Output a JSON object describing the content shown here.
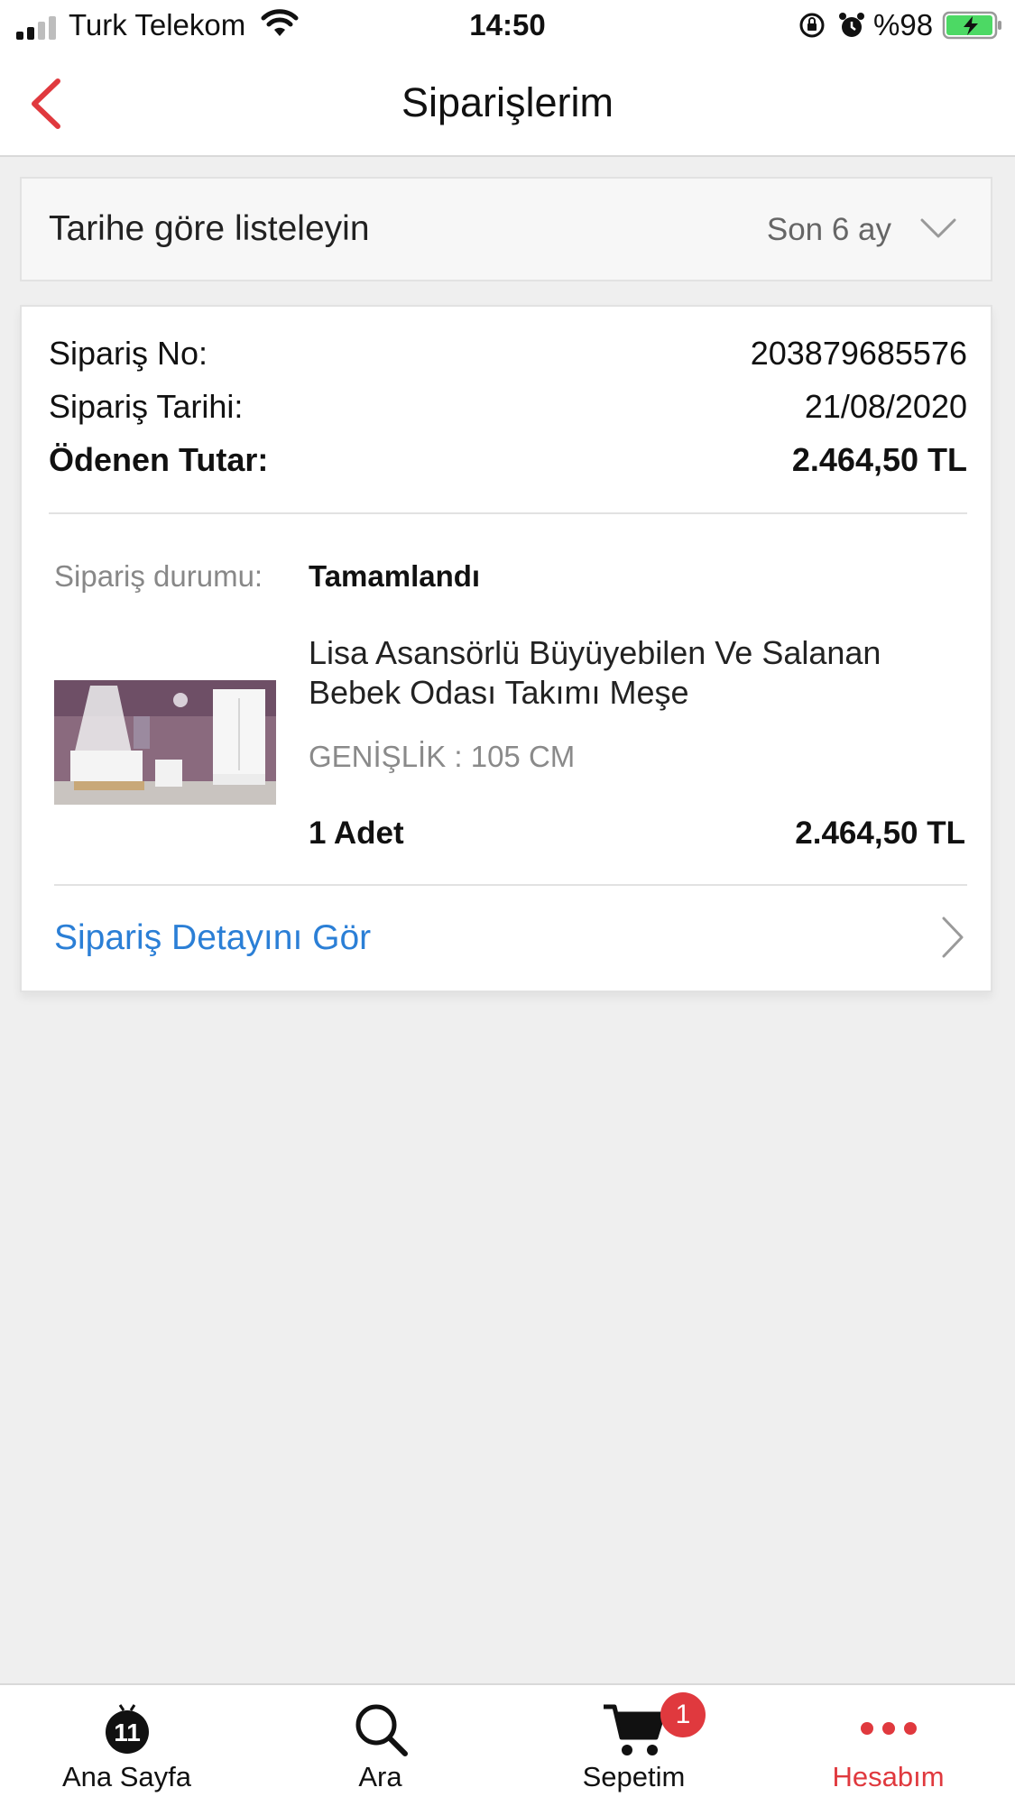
{
  "status_bar": {
    "carrier": "Turk Telekom",
    "time": "14:50",
    "battery_percent": "%98",
    "battery_level": 0.98
  },
  "nav": {
    "title": "Siparişlerim",
    "back_icon": "chevron-left-icon",
    "accent_color": "#e0393e"
  },
  "filter": {
    "label": "Tarihe göre listeleyin",
    "selected": "Son 6 ay",
    "icon": "chevron-down-icon"
  },
  "order": {
    "number_label": "Sipariş No:",
    "number": "203879685576",
    "date_label": "Sipariş Tarihi:",
    "date": "21/08/2020",
    "paid_label": "Ödenen Tutar:",
    "paid": "2.464,50 TL",
    "status_label": "Sipariş durumu:",
    "status": "Tamamlandı",
    "item": {
      "title": "Lisa Asansörlü Büyüyebilen Ve Salanan Bebek Odası Takımı Meşe",
      "variant": "GENİŞLİK : 105 CM",
      "quantity": "1 Adet",
      "price": "2.464,50 TL"
    },
    "detail_link": "Sipariş Detayını Gör",
    "link_color": "#2b7fd6"
  },
  "tabs": [
    {
      "label": "Ana Sayfa",
      "icon": "home-logo-icon"
    },
    {
      "label": "Ara",
      "icon": "search-icon"
    },
    {
      "label": "Sepetim",
      "icon": "cart-icon",
      "badge": "1"
    },
    {
      "label": "Hesabım",
      "icon": "more-dots-icon",
      "active": true
    }
  ]
}
